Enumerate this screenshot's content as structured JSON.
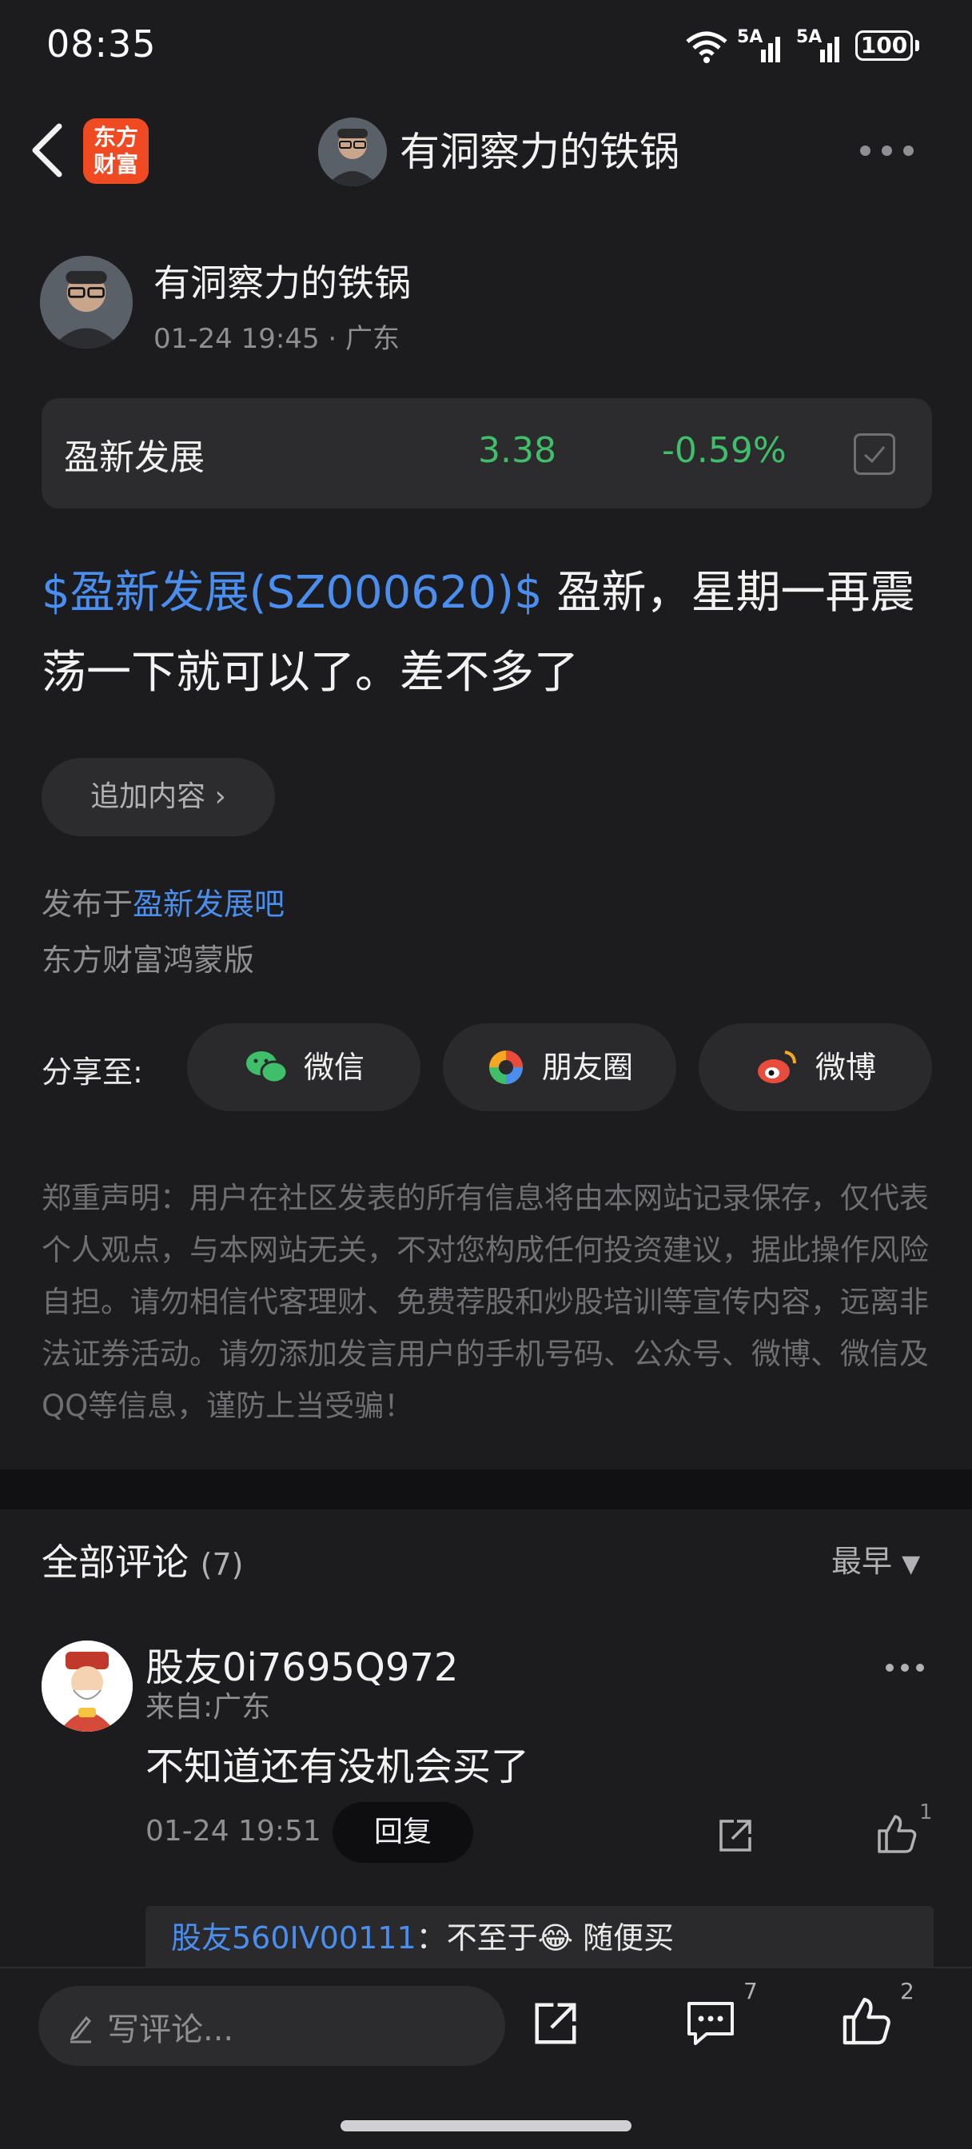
{
  "status_bar": {
    "time": "08:35",
    "signal_1": "5A",
    "signal_2": "5A",
    "battery": "100"
  },
  "nav": {
    "title": "有洞察力的铁锅",
    "logo_line1": "东方",
    "logo_line2": "财富"
  },
  "author": {
    "name": "有洞察力的铁锅",
    "meta": "01-24 19:45 · 广东"
  },
  "stock": {
    "name": "盈新发展",
    "price": "3.38",
    "change": "-0.59%",
    "color_down": "#3fbf6a"
  },
  "post": {
    "tag": "$盈新发展(SZ000620)$",
    "text": " 盈新，星期一再震荡一下就可以了。差不多了"
  },
  "append_label": "追加内容",
  "publish": {
    "prefix": "发布于",
    "forum": "盈新发展吧"
  },
  "version": "东方财富鸿蒙版",
  "share": {
    "label": "分享至:",
    "wechat": "微信",
    "moments": "朋友圈",
    "weibo": "微博"
  },
  "disclaimer": "郑重声明：用户在社区发表的所有信息将由本网站记录保存，仅代表个人观点，与本网站无关，不对您构成任何投资建议，据此操作风险自担。请勿相信代客理财、免费荐股和炒股培训等宣传内容，远离非法证券活动。请勿添加发言用户的手机号码、公众号、微博、微信及QQ等信息，谨防上当受骗！",
  "comments": {
    "title": "全部评论",
    "count": "(7)",
    "sort": "最早",
    "items": [
      {
        "user": "股友0i7695Q972",
        "location": "来自:广东",
        "text": "不知道还有没机会买了",
        "time": "01-24 19:51",
        "reply_label": "回复",
        "likes": "1",
        "sub_reply_user": "股友560IV00111",
        "sub_reply_text": "：不至于😂 随便买"
      }
    ]
  },
  "bottom_bar": {
    "input_placeholder": "写评论...",
    "comment_count": "7",
    "like_count": "2"
  },
  "colors": {
    "accent_blue": "#4a8ef0",
    "green": "#3fbf6a",
    "brand_orange": "#f04a23",
    "background": "#1c1c1e"
  }
}
